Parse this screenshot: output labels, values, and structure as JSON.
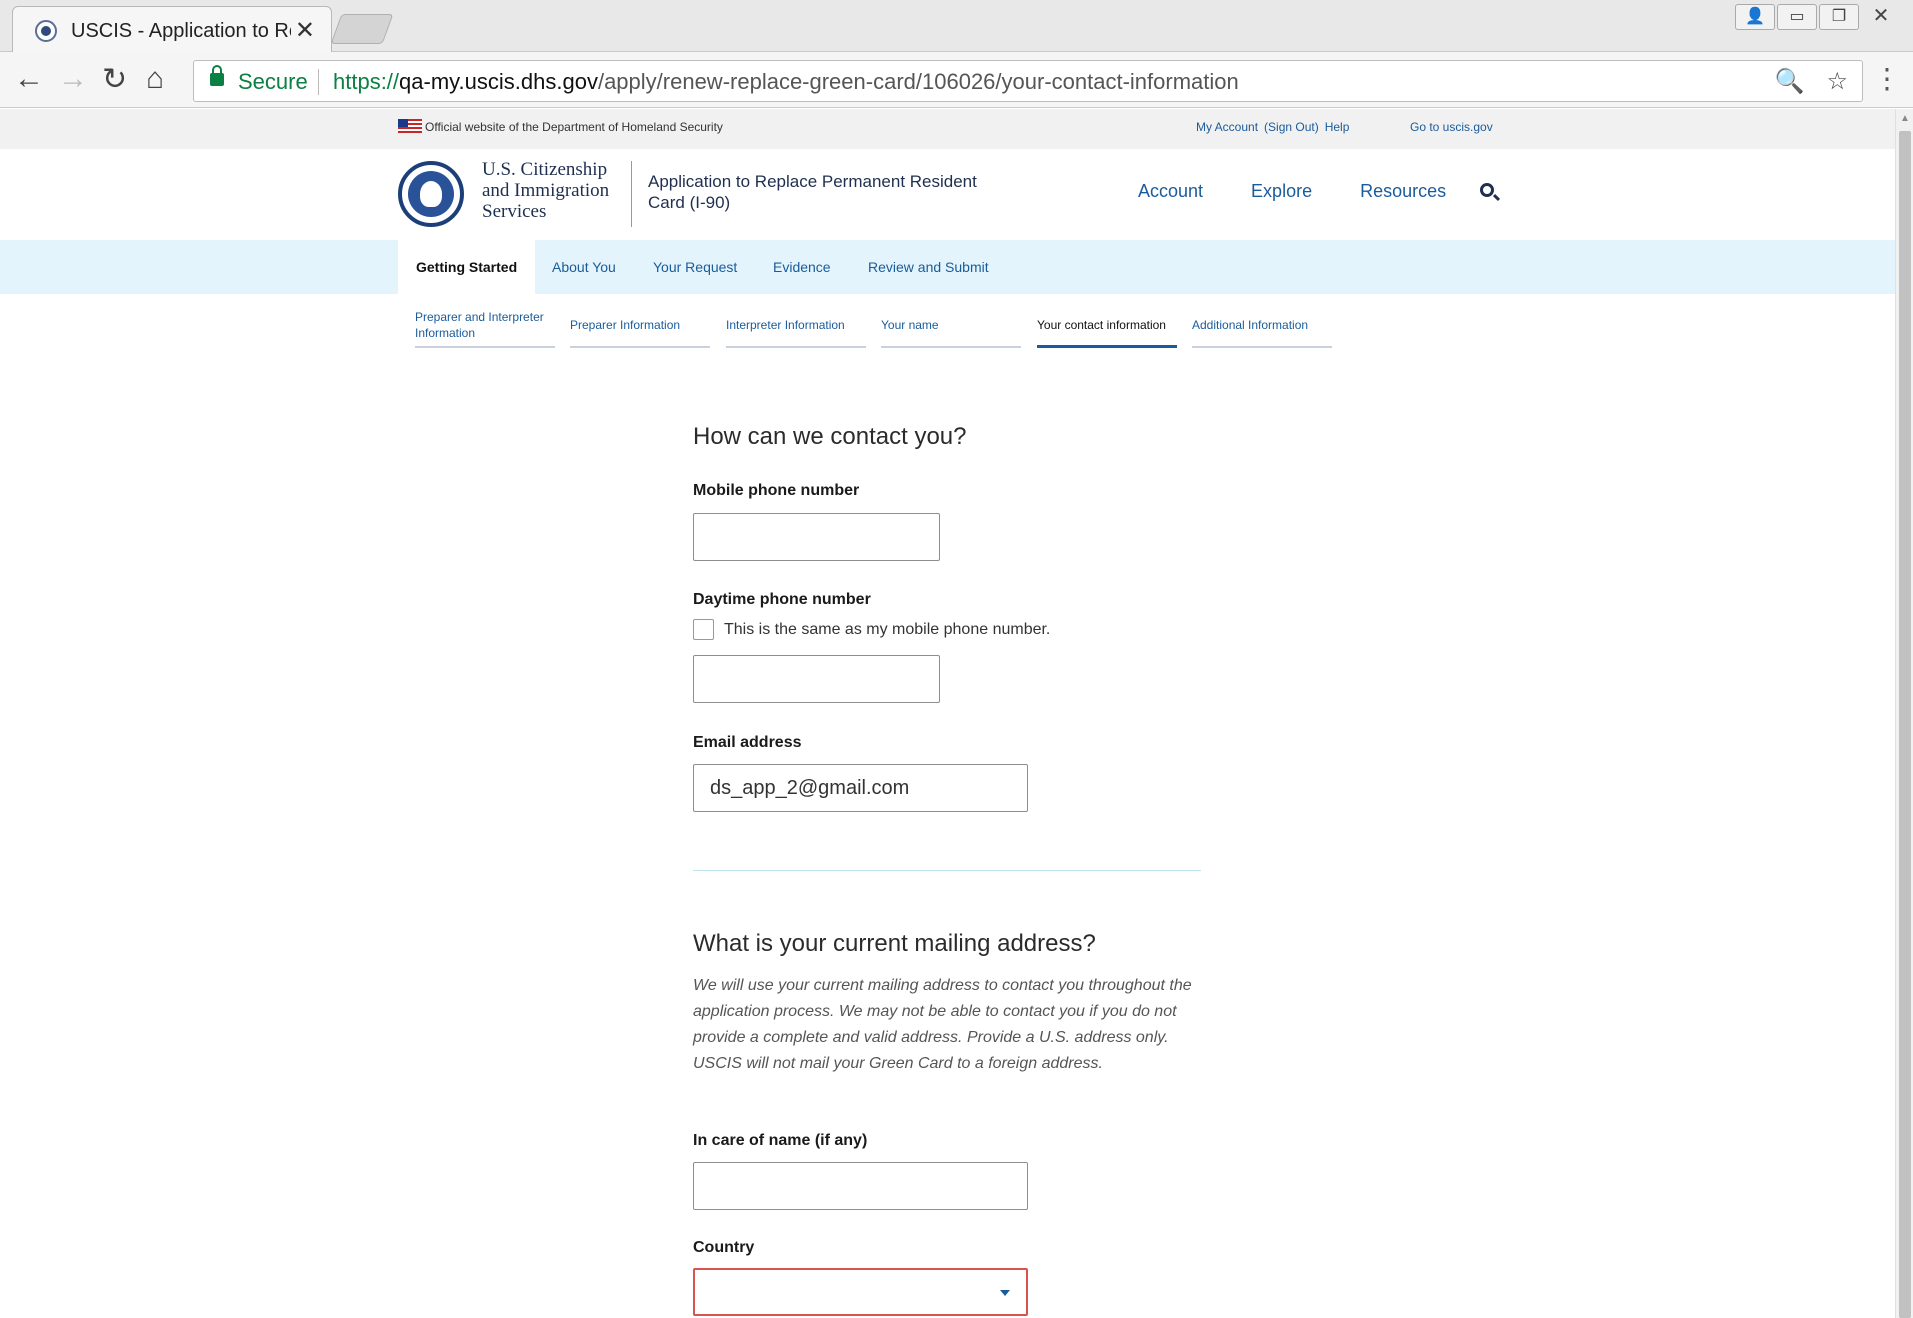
{
  "browser": {
    "tab_title": "USCIS - Application to Re",
    "close_glyph": "✕",
    "secure_label": "Secure",
    "url_proto": "https://",
    "url_host": "qa-my.uscis.dhs.gov",
    "url_path": "/apply/renew-replace-green-card/106026/your-contact-information",
    "icons": [
      "back-icon",
      "forward-icon",
      "reload-icon",
      "home-icon",
      "lock-icon",
      "zoom-icon",
      "star-icon",
      "menu-icon"
    ]
  },
  "gov_banner": {
    "official_text": "Official website of the Department of Homeland Security",
    "links": [
      "My Account",
      "(Sign Out)",
      "Help"
    ],
    "goto": "Go to uscis.gov"
  },
  "header": {
    "agency_name": "U.S. Citizenship and Immigration Services",
    "application_title": "Application to Replace Permanent Resident Card (I-90)",
    "nav": [
      "Account",
      "Explore",
      "Resources"
    ]
  },
  "section_nav": {
    "items": [
      "Getting Started",
      "About You",
      "Your Request",
      "Evidence",
      "Review and Submit"
    ],
    "active": "Getting Started"
  },
  "steps": {
    "items": [
      "Preparer and Interpreter Information",
      "Preparer Information",
      "Interpreter Information",
      "Your name",
      "Your contact information",
      "Additional Information"
    ],
    "active": "Your contact information"
  },
  "form": {
    "contact_heading": "How can we contact you?",
    "mobile_label": "Mobile phone number",
    "mobile_value": "",
    "daytime_label": "Daytime phone number",
    "same_as_mobile_label": "This is the same as my mobile phone number.",
    "same_as_mobile_checked": false,
    "daytime_value": "",
    "email_label": "Email address",
    "email_value": "ds_app_2@gmail.com",
    "mailing_heading": "What is your current mailing address?",
    "mailing_help": "We will use your current mailing address to contact you throughout the application process. We may not be able to contact you if you do not provide a complete and valid address. Provide a U.S. address only. USCIS will not mail your Green Card to a foreign address.",
    "care_of_label": "In care of name (if any)",
    "care_of_value": "",
    "country_label": "Country",
    "country_value": ""
  },
  "colors": {
    "link": "#1a5c9b",
    "section_nav_bg": "#e3f4fc",
    "secure_green": "#0b8043",
    "error_border": "#d9534f"
  }
}
